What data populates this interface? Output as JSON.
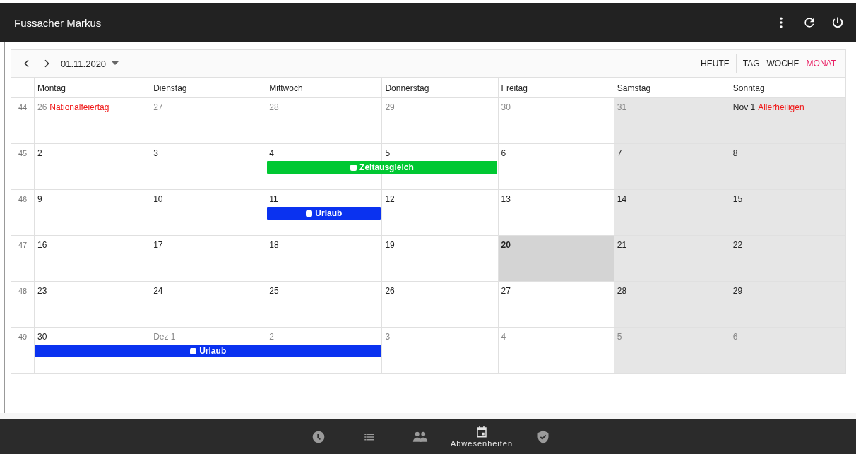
{
  "app_bar": {
    "title": "Fussacher Markus"
  },
  "toolbar": {
    "date": "01.11.2020",
    "today_button": "HEUTE",
    "views": [
      {
        "label": "TAG",
        "selected": false
      },
      {
        "label": "WOCHE",
        "selected": false
      },
      {
        "label": "MONAT",
        "selected": true
      }
    ]
  },
  "weekdays": [
    "Montag",
    "Dienstag",
    "Mittwoch",
    "Donnerstag",
    "Freitag",
    "Samstag",
    "Sonntag"
  ],
  "weeks": [
    {
      "number": "44",
      "days": [
        {
          "date": "26",
          "muted": true,
          "weekend": false,
          "today": false,
          "holiday": "Nationalfeiertag"
        },
        {
          "date": "27",
          "muted": true,
          "weekend": false,
          "today": false
        },
        {
          "date": "28",
          "muted": true,
          "weekend": false,
          "today": false
        },
        {
          "date": "29",
          "muted": true,
          "weekend": false,
          "today": false
        },
        {
          "date": "30",
          "muted": true,
          "weekend": false,
          "today": false
        },
        {
          "date": "31",
          "muted": true,
          "weekend": true,
          "today": false
        },
        {
          "date": "Nov 1",
          "muted": false,
          "weekend": true,
          "today": false,
          "holiday": "Allerheiligen"
        }
      ]
    },
    {
      "number": "45",
      "days": [
        {
          "date": "2",
          "muted": false,
          "weekend": false,
          "today": false
        },
        {
          "date": "3",
          "muted": false,
          "weekend": false,
          "today": false
        },
        {
          "date": "4",
          "muted": false,
          "weekend": false,
          "today": false,
          "event": {
            "label": "Zeitausgleich",
            "color": "#00c832"
          }
        },
        {
          "date": "5",
          "muted": false,
          "weekend": false,
          "today": false,
          "continues": true
        },
        {
          "date": "6",
          "muted": false,
          "weekend": false,
          "today": false
        },
        {
          "date": "7",
          "muted": false,
          "weekend": true,
          "today": false
        },
        {
          "date": "8",
          "muted": false,
          "weekend": true,
          "today": false
        }
      ]
    },
    {
      "number": "46",
      "days": [
        {
          "date": "9",
          "muted": false,
          "weekend": false,
          "today": false
        },
        {
          "date": "10",
          "muted": false,
          "weekend": false,
          "today": false
        },
        {
          "date": "11",
          "muted": false,
          "weekend": false,
          "today": false,
          "event": {
            "label": "Urlaub",
            "color": "#0a32f0"
          }
        },
        {
          "date": "12",
          "muted": false,
          "weekend": false,
          "today": false
        },
        {
          "date": "13",
          "muted": false,
          "weekend": false,
          "today": false
        },
        {
          "date": "14",
          "muted": false,
          "weekend": true,
          "today": false
        },
        {
          "date": "15",
          "muted": false,
          "weekend": true,
          "today": false
        }
      ]
    },
    {
      "number": "47",
      "days": [
        {
          "date": "16",
          "muted": false,
          "weekend": false,
          "today": false
        },
        {
          "date": "17",
          "muted": false,
          "weekend": false,
          "today": false
        },
        {
          "date": "18",
          "muted": false,
          "weekend": false,
          "today": false
        },
        {
          "date": "19",
          "muted": false,
          "weekend": false,
          "today": false
        },
        {
          "date": "20",
          "muted": false,
          "weekend": false,
          "today": true
        },
        {
          "date": "21",
          "muted": false,
          "weekend": true,
          "today": false
        },
        {
          "date": "22",
          "muted": false,
          "weekend": true,
          "today": false
        }
      ]
    },
    {
      "number": "48",
      "days": [
        {
          "date": "23",
          "muted": false,
          "weekend": false,
          "today": false
        },
        {
          "date": "24",
          "muted": false,
          "weekend": false,
          "today": false
        },
        {
          "date": "25",
          "muted": false,
          "weekend": false,
          "today": false
        },
        {
          "date": "26",
          "muted": false,
          "weekend": false,
          "today": false
        },
        {
          "date": "27",
          "muted": false,
          "weekend": false,
          "today": false
        },
        {
          "date": "28",
          "muted": false,
          "weekend": true,
          "today": false
        },
        {
          "date": "29",
          "muted": false,
          "weekend": true,
          "today": false
        }
      ]
    },
    {
      "number": "49",
      "days": [
        {
          "date": "30",
          "muted": false,
          "weekend": false,
          "today": false,
          "event": {
            "label": "Urlaub",
            "color": "#0a32f0"
          }
        },
        {
          "date": "Dez 1",
          "muted": true,
          "weekend": false,
          "today": false,
          "continues": true
        },
        {
          "date": "2",
          "muted": true,
          "weekend": false,
          "today": false,
          "continues": true
        },
        {
          "date": "3",
          "muted": true,
          "weekend": false,
          "today": false
        },
        {
          "date": "4",
          "muted": true,
          "weekend": false,
          "today": false
        },
        {
          "date": "5",
          "muted": true,
          "weekend": true,
          "today": false
        },
        {
          "date": "6",
          "muted": true,
          "weekend": true,
          "today": false
        }
      ]
    }
  ],
  "bottom_nav": [
    {
      "kind": "clock",
      "selected": false
    },
    {
      "kind": "list",
      "selected": false
    },
    {
      "kind": "people",
      "selected": false
    },
    {
      "kind": "calendar",
      "selected": true,
      "label": "Abwesenheiten"
    },
    {
      "kind": "shield",
      "selected": false
    }
  ]
}
